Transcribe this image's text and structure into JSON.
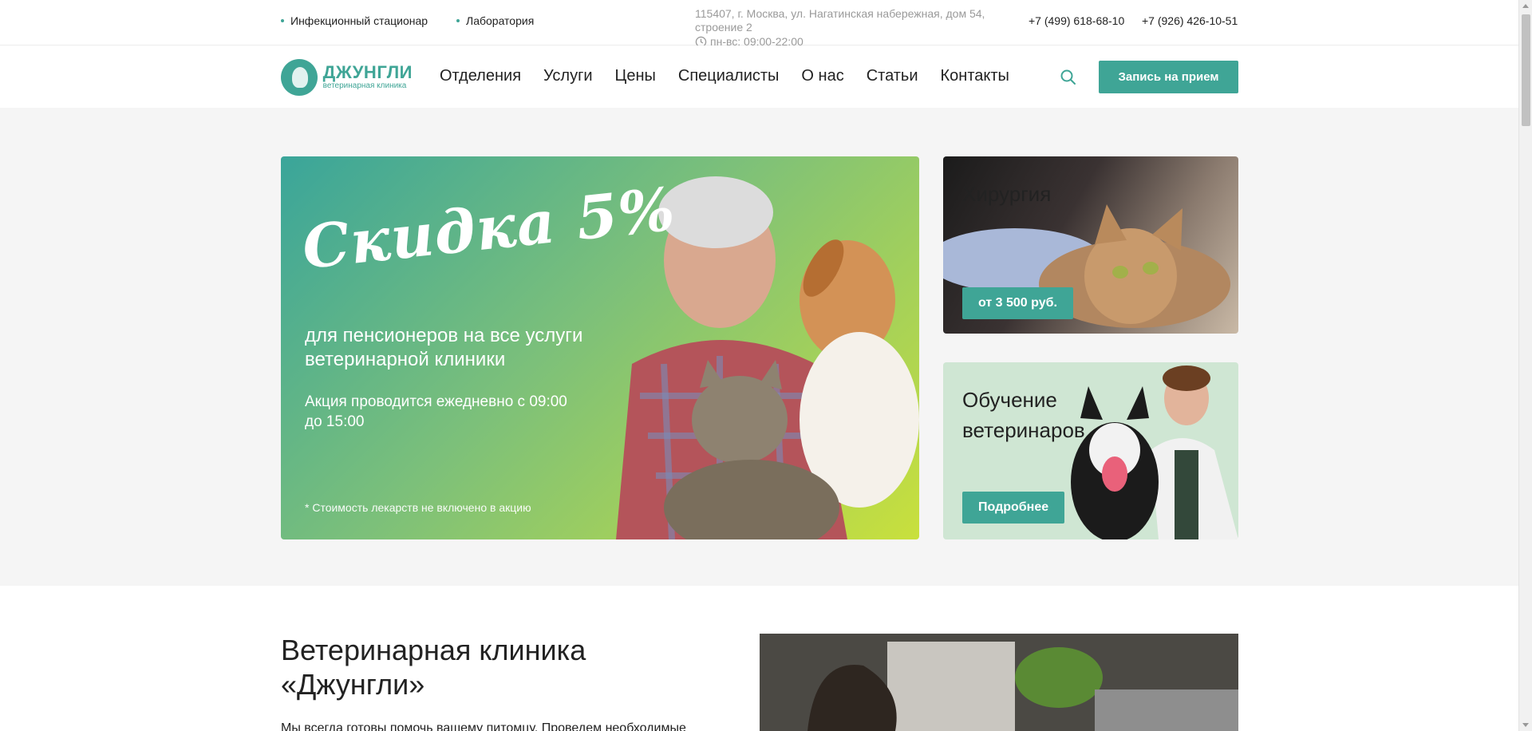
{
  "topbar": {
    "links": [
      "Инфекционный стационар",
      "Лаборатория"
    ],
    "address": "115407, г. Москва, ул. Нагатинская набережная, дом 54, строение 2",
    "hours": "пн-вс: 09:00-22:00",
    "phones": [
      "+7 (499) 618-68-10",
      "+7 (926) 426-10-51"
    ]
  },
  "header": {
    "logo_title": "ДЖУНГЛИ",
    "logo_subtitle": "ветеринарная клиника",
    "menu": [
      "Отделения",
      "Услуги",
      "Цены",
      "Специалисты",
      "О нас",
      "Статьи",
      "Контакты"
    ],
    "cta_label": "Запись на прием"
  },
  "promo": {
    "headline": "Скидка 5%",
    "lead": "для пенсионеров на все услуги ветеринарной клиники",
    "note": "Акция проводится ежедневно с 09:00 до 15:00",
    "footnote": "* Стоимость лекарств не включено в акцию"
  },
  "cards": [
    {
      "title": "Хирургия",
      "badge": "от 3 500 руб."
    },
    {
      "title": "Обучение ветеринаров",
      "badge": "Подробнее"
    }
  ],
  "about": {
    "title": "Ветеринарная клиника «Джунгли»",
    "text": "Мы всегда готовы помочь вашему питомцу. Проведем необходимые"
  },
  "colors": {
    "accent": "#3fa596",
    "hero_bg": "#f5f5f5"
  }
}
